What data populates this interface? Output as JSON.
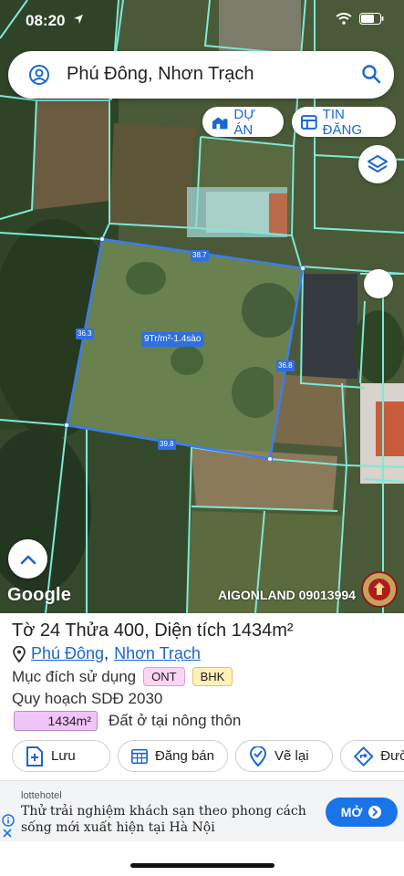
{
  "status_bar": {
    "time": "08:20"
  },
  "search": {
    "query": "Phú Đông, Nhơn Trạch"
  },
  "chips": {
    "du_an": "DỰ ÁN",
    "tin_dang": "TIN ĐĂNG"
  },
  "map": {
    "plot_label": "9Tr/m²-1.4sào",
    "edges": {
      "top": "38.7",
      "left": "36.3",
      "right": "36.8",
      "bottom": "39.8"
    },
    "google_logo": "Google",
    "watermark": "AIGONLAND 09013994",
    "colors": {
      "parcel_line": "#7fe8d6",
      "selected_plot": "#3b7cf0"
    }
  },
  "parcel": {
    "title": "Tờ 24 Thửa 400, Diện tích 1434m²",
    "ward": "Phú Đông",
    "separator": ",",
    "district": "Nhơn Trạch",
    "purpose_label": "Mục đích sử dụng",
    "purpose_codes": [
      "ONT",
      "BHK"
    ],
    "plan_label": "Quy hoạch SDĐ 2030",
    "area_value": "1434m²",
    "area_desc": "Đất ở tại nông thôn"
  },
  "actions": {
    "save": "Lưu",
    "sell": "Đăng bán",
    "redraw": "Vẽ lại",
    "directions": "Đườ"
  },
  "ad": {
    "brand": "lottehotel",
    "text": "Thử trải nghiệm khách sạn theo phong cách sống mới xuất hiện tại Hà Nội",
    "cta": "MỞ"
  }
}
